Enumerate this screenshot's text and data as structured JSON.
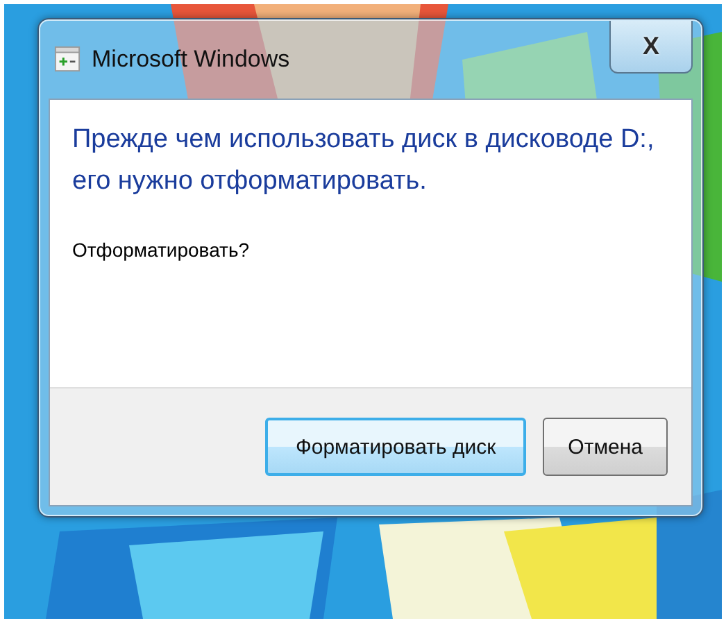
{
  "window": {
    "title": "Microsoft Windows",
    "close": "X"
  },
  "message": {
    "main": "Прежде чем использовать диск в дисководе D:, его нужно отформатировать.",
    "question": "Отформатировать?"
  },
  "buttons": [
    {
      "label": "Форматировать диск",
      "kind": "default"
    },
    {
      "label": "Отмена",
      "kind": "normal"
    }
  ]
}
